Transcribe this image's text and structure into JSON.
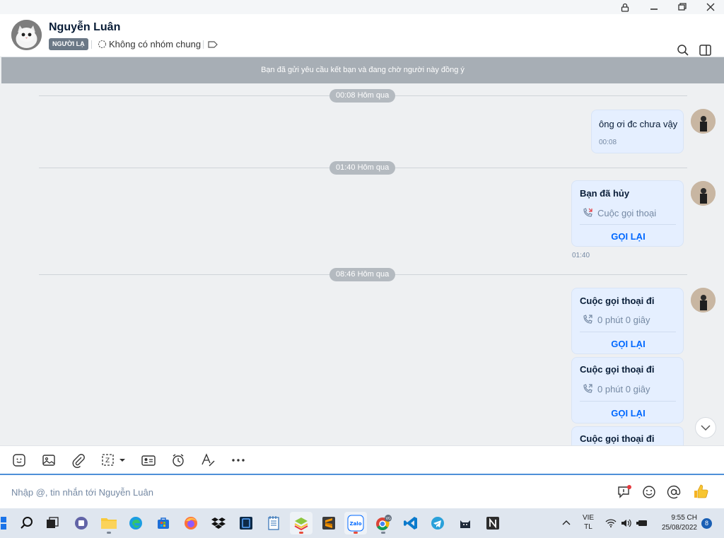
{
  "window": {
    "lock_icon": "lock-icon",
    "minimize_icon": "minimize-icon",
    "restore_icon": "restore-icon",
    "close_icon": "close-icon"
  },
  "header": {
    "contact_name": "Nguyễn Luân",
    "stranger_badge": "NGƯỜI LẠ",
    "common_groups": "Không có nhóm chung",
    "icons": [
      "search-icon",
      "sidebar-panel-icon",
      "tag-icon",
      "group-icon"
    ]
  },
  "banner": {
    "text": "Bạn đã gửi yêu cầu kết bạn và đang chờ người này đồng ý"
  },
  "messages": {
    "date_1": "00:08 Hôm qua",
    "msg_1_text": "ông ơi đc chưa vậy",
    "msg_1_time": "00:08",
    "date_2": "01:40 Hôm qua",
    "call_1_title": "Bạn đã hủy",
    "call_1_sub": "Cuộc gọi thoại",
    "call_1_action": "GỌI LẠI",
    "call_1_time": "01:40",
    "date_3": "08:46 Hôm qua",
    "call_2_title": "Cuộc gọi thoại đi",
    "call_2_sub": "0 phút 0 giây",
    "call_2_action": "GỌI LẠI",
    "call_3_title": "Cuộc gọi thoại đi",
    "call_3_sub": "0 phút 0 giây",
    "call_3_action": "GỌI LẠI",
    "call_4_title": "Cuộc gọi thoại đi"
  },
  "toolbar": {
    "icons": [
      "sticker-icon",
      "image-icon",
      "attachment-icon",
      "screenshot-icon",
      "contact-card-icon",
      "reminder-icon",
      "text-format-icon",
      "more-icon"
    ]
  },
  "composer": {
    "placeholder": "Nhập @, tin nhắn tới Nguyễn Luân",
    "icons": [
      "quick-message-icon",
      "emoji-icon",
      "mention-icon",
      "thumbs-up-icon"
    ]
  },
  "taskbar": {
    "apps": [
      "start",
      "search",
      "task-view",
      "teams",
      "file-explorer",
      "edge",
      "store",
      "firefox",
      "dropbox",
      "app",
      "notepad",
      "bluestacks",
      "sublime-text",
      "zalo",
      "chrome",
      "vscode",
      "telegram",
      "app",
      "notion"
    ],
    "lang_line1": "VIE",
    "lang_line2": "TL",
    "time": "9:55 CH",
    "date": "25/08/2022",
    "notifications": "8",
    "chrome_profile": "VG"
  },
  "colors": {
    "accent": "#0068ff",
    "bubble": "#e5efff",
    "banner": "#a7aeb5",
    "stranger_badge": "#6b7886"
  }
}
